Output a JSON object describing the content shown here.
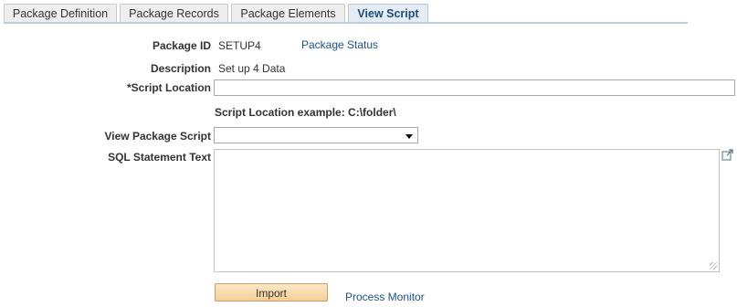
{
  "tabs": [
    {
      "label": "Package Definition",
      "active": false
    },
    {
      "label": "Package Records",
      "active": false
    },
    {
      "label": "Package Elements",
      "active": false
    },
    {
      "label": "View Script",
      "active": true
    }
  ],
  "form": {
    "package_id_label": "Package ID",
    "package_id_value": "SETUP4",
    "package_status_link": "Package Status",
    "description_label": "Description",
    "description_value": "Set up 4 Data",
    "script_location_label": "*Script Location",
    "script_location_value": "",
    "script_location_example": "Script Location example: C:\\folder\\",
    "view_package_script_label": "View Package Script",
    "view_package_script_value": "",
    "sql_statement_label": "SQL Statement Text",
    "sql_statement_value": ""
  },
  "actions": {
    "import_label": "Import",
    "process_monitor_link": "Process Monitor"
  },
  "icons": {
    "expand": "expand-icon",
    "dropdown": "chevron-down-icon"
  }
}
